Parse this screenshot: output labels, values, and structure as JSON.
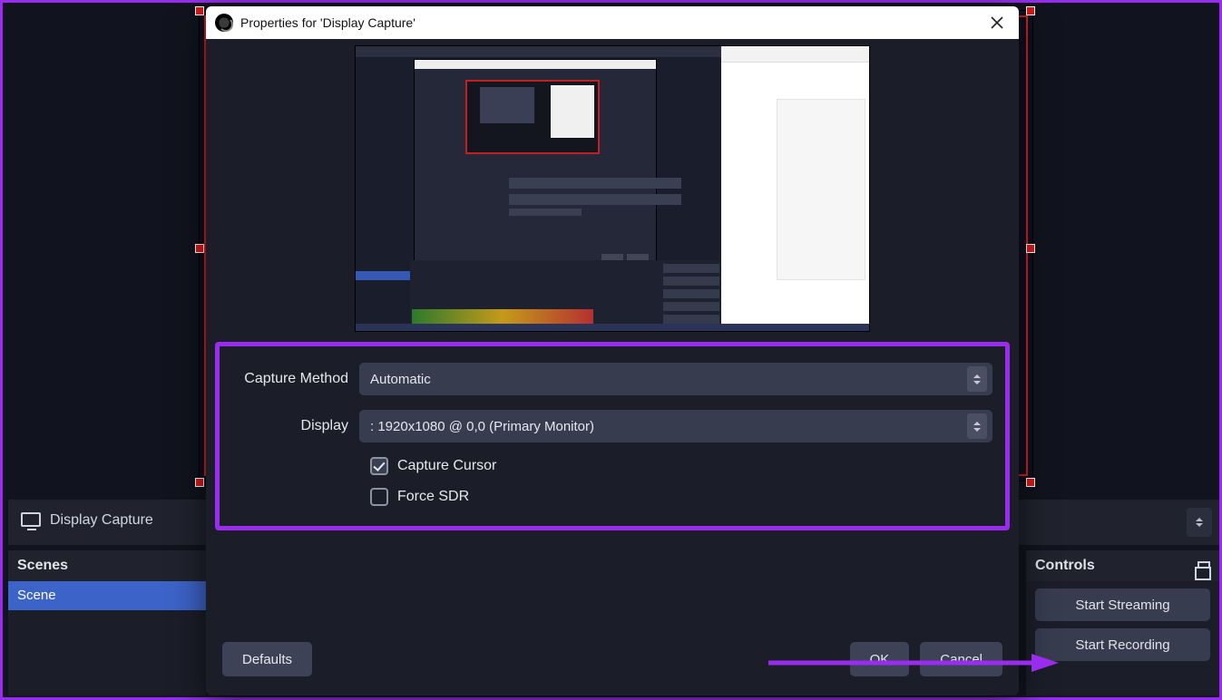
{
  "bg": {
    "source_label": "Display Capture",
    "scenes_header": "Scenes",
    "scene_name": "Scene",
    "controls_header": "Controls",
    "start_streaming": "Start Streaming",
    "start_recording": "Start Recording"
  },
  "dialog": {
    "title": "Properties for 'Display Capture'",
    "capture_method_label": "Capture Method",
    "capture_method_value": "Automatic",
    "display_label": "Display",
    "display_value": ": 1920x1080 @ 0,0 (Primary Monitor)",
    "capture_cursor_label": "Capture Cursor",
    "capture_cursor_checked": true,
    "force_sdr_label": "Force SDR",
    "force_sdr_checked": false,
    "defaults_btn": "Defaults",
    "ok_btn": "OK",
    "cancel_btn": "Cancel"
  },
  "annotation": {
    "highlight_color": "#9a2cf0"
  }
}
